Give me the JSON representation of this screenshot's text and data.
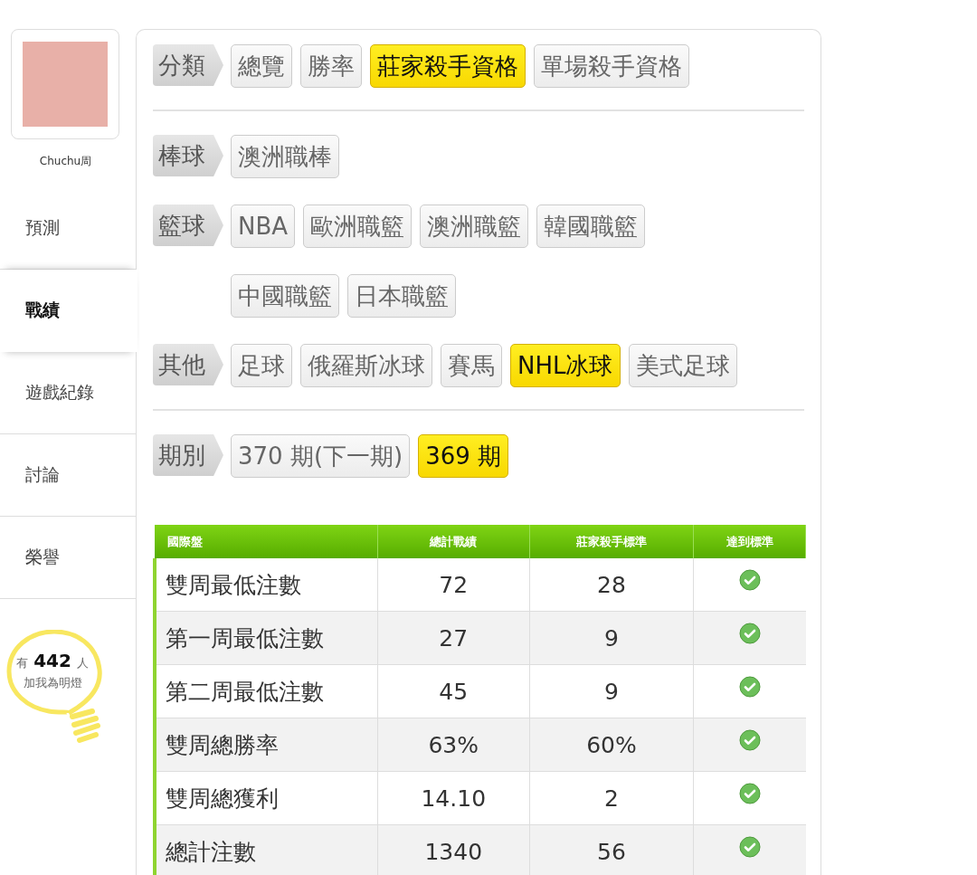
{
  "profile": {
    "name": "Chuchu周"
  },
  "nav": [
    {
      "label": "預測",
      "selected": false
    },
    {
      "label": "戰績",
      "selected": true
    },
    {
      "label": "遊戲紀錄",
      "selected": false
    },
    {
      "label": "討論",
      "selected": false
    },
    {
      "label": "榮譽",
      "selected": false
    }
  ],
  "fans": {
    "prefix": "有",
    "count": "442",
    "suffix": "人",
    "caption": "加我為明燈"
  },
  "filters": [
    {
      "label": "分類",
      "divider_after": true,
      "rows": [
        [
          {
            "label": "總覽",
            "selected": false
          },
          {
            "label": "勝率",
            "selected": false
          },
          {
            "label": "莊家殺手資格",
            "selected": true
          },
          {
            "label": "單場殺手資格",
            "selected": false
          }
        ]
      ]
    },
    {
      "label": "棒球",
      "divider_after": false,
      "rows": [
        [
          {
            "label": "澳洲職棒",
            "selected": false
          }
        ]
      ]
    },
    {
      "label": "籃球",
      "divider_after": false,
      "rows": [
        [
          {
            "label": "NBA",
            "selected": false
          },
          {
            "label": "歐洲職籃",
            "selected": false
          },
          {
            "label": "澳洲職籃",
            "selected": false
          },
          {
            "label": "韓國職籃",
            "selected": false
          }
        ],
        [
          {
            "label": "中國職籃",
            "selected": false
          },
          {
            "label": "日本職籃",
            "selected": false
          }
        ]
      ]
    },
    {
      "label": "其他",
      "divider_after": true,
      "rows": [
        [
          {
            "label": "足球",
            "selected": false
          },
          {
            "label": "俄羅斯冰球",
            "selected": false
          },
          {
            "label": "賽馬",
            "selected": false
          },
          {
            "label": "NHL冰球",
            "selected": true
          },
          {
            "label": "美式足球",
            "selected": false
          }
        ]
      ]
    },
    {
      "label": "期別",
      "divider_after": false,
      "rows": [
        [
          {
            "label": "370 期(下一期)",
            "selected": false
          },
          {
            "label": "369 期",
            "selected": true
          }
        ]
      ]
    }
  ],
  "table": {
    "columns": [
      "國際盤",
      "總計戰績",
      "莊家殺手標準",
      "達到標準"
    ],
    "rows": [
      {
        "name": "雙周最低注數",
        "total": "72",
        "standard": "28",
        "reached": true
      },
      {
        "name": "第一周最低注數",
        "total": "27",
        "standard": "9",
        "reached": true
      },
      {
        "name": "第二周最低注數",
        "total": "45",
        "standard": "9",
        "reached": true
      },
      {
        "name": "雙周總勝率",
        "total": "63%",
        "standard": "60%",
        "reached": true
      },
      {
        "name": "雙周總獲利",
        "total": "14.10",
        "standard": "2",
        "reached": true
      },
      {
        "name": "總計注數",
        "total": "1340",
        "standard": "56",
        "reached": true
      }
    ]
  }
}
